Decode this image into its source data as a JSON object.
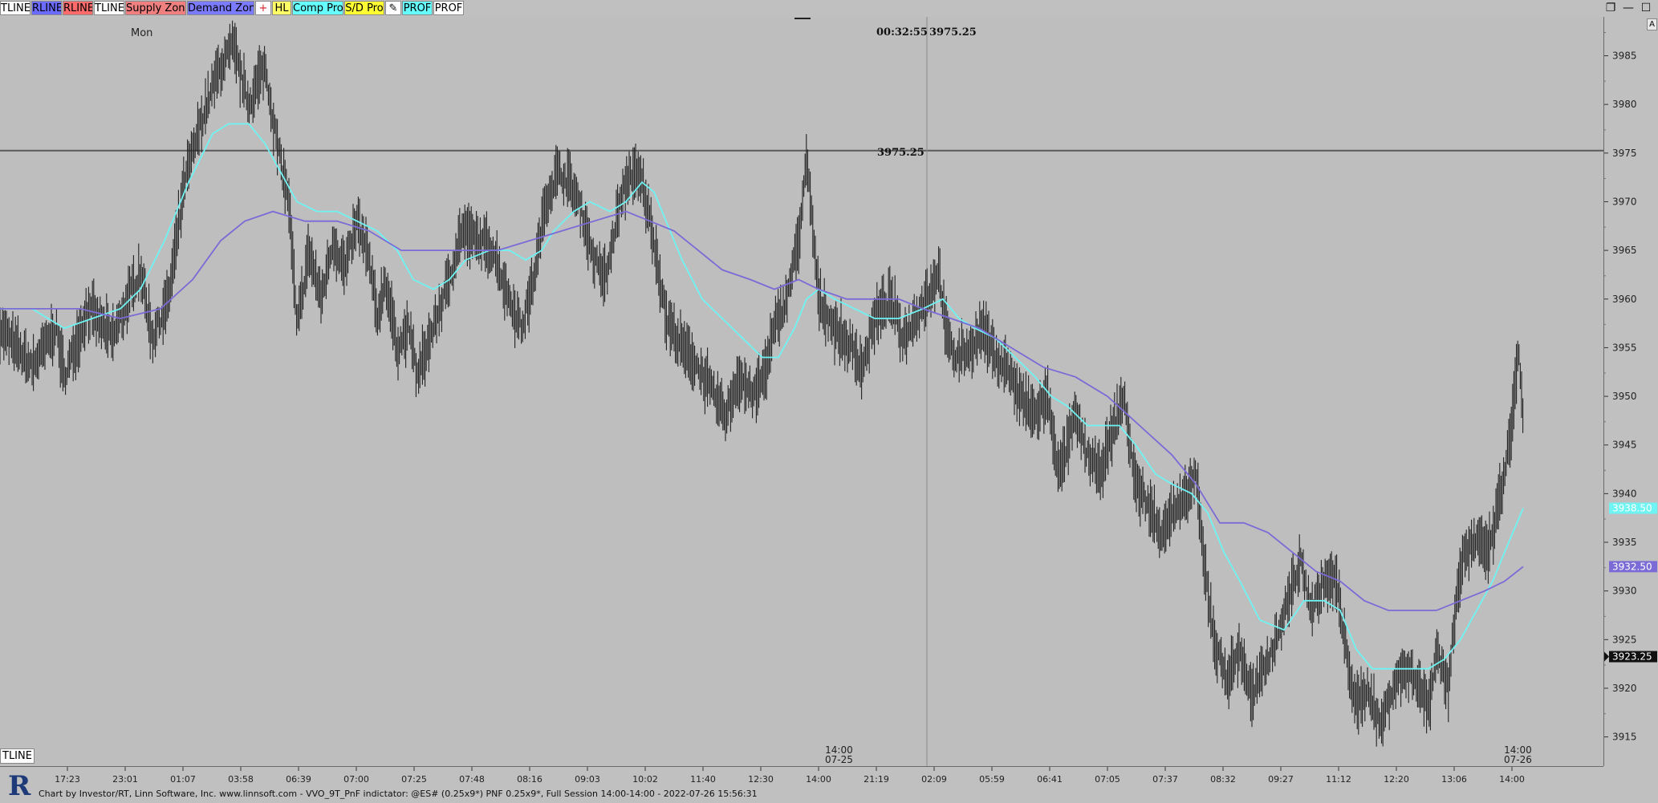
{
  "toolbar": {
    "buttons": [
      {
        "label": "TLINE",
        "bg": "#ffffff",
        "color": "#000000"
      },
      {
        "label": "RLINE",
        "bg": "#6b6bff",
        "color": "#000000"
      },
      {
        "label": "RLINE",
        "bg": "#ff6b6b",
        "color": "#000000"
      },
      {
        "label": "TLINE",
        "bg": "#ffffff",
        "color": "#000000"
      },
      {
        "label": "Supply Zone",
        "bg": "#f08080",
        "color": "#000000"
      },
      {
        "label": "Demand Zone",
        "bg": "#7b7bff",
        "color": "#000000"
      },
      {
        "label": "+",
        "bg": "#ffffff",
        "color": "#d02020"
      },
      {
        "label": "HL",
        "bg": "#ffff66",
        "color": "#000000"
      },
      {
        "label": "Comp Prof",
        "bg": "#66ffff",
        "color": "#000000"
      },
      {
        "label": "S/D Pro",
        "bg": "#ffff33",
        "color": "#000000"
      },
      {
        "label": "✎",
        "bg": "#ffffff",
        "color": "#000000"
      },
      {
        "label": "PROF",
        "bg": "#66ffff",
        "color": "#000000"
      },
      {
        "label": "PROF",
        "bg": "#ffffff",
        "color": "#000000"
      }
    ],
    "window_controls": [
      "❐",
      "—",
      "☐"
    ]
  },
  "chart": {
    "day_label": "Mon",
    "cursor_readout_time": "00:32:55",
    "cursor_readout_price": "3975.25",
    "hline_label": "3975.25",
    "tline_label": "TLINE",
    "axis_corner_label": "A",
    "session_marker_mid": {
      "time": "14:00",
      "date": "07-25"
    },
    "session_marker_end": {
      "time": "14:00",
      "date": "07-26"
    },
    "colors": {
      "bars": "#222222",
      "fast_ma": "#6ff3f3",
      "slow_ma": "#7a6bd6",
      "hline": "#5a5a5a",
      "last_price_bg": "#111111"
    },
    "price_labels": {
      "fast_ma": "3938.50",
      "slow_ma": "3932.50",
      "last": "3923.25"
    }
  },
  "chart_data": {
    "type": "bar",
    "instrument": "@ES#",
    "ylim": [
      3912,
      3989
    ],
    "y_ticks": [
      "3985",
      "3980",
      "3975",
      "3970",
      "3965",
      "3960",
      "3955",
      "3950",
      "3945",
      "3940",
      "3935",
      "3930",
      "3925",
      "3920",
      "3915"
    ],
    "x_ticks": [
      "17:23",
      "23:01",
      "01:07",
      "03:58",
      "06:39",
      "07:00",
      "07:25",
      "07:48",
      "08:16",
      "09:03",
      "10:02",
      "11:40",
      "12:30",
      "14:00",
      "21:19",
      "02:09",
      "05:59",
      "06:41",
      "07:05",
      "07:37",
      "08:32",
      "09:27",
      "11:12",
      "12:20",
      "13:06",
      "14:00"
    ],
    "price_path": [
      [
        0,
        3957
      ],
      [
        40,
        3953
      ],
      [
        70,
        3957
      ],
      [
        80,
        3952
      ],
      [
        110,
        3959
      ],
      [
        140,
        3956
      ],
      [
        175,
        3963
      ],
      [
        190,
        3956
      ],
      [
        210,
        3960
      ],
      [
        230,
        3972
      ],
      [
        250,
        3978
      ],
      [
        270,
        3983
      ],
      [
        290,
        3986
      ],
      [
        310,
        3980
      ],
      [
        330,
        3984
      ],
      [
        345,
        3976
      ],
      [
        360,
        3970
      ],
      [
        370,
        3957
      ],
      [
        385,
        3965
      ],
      [
        400,
        3960
      ],
      [
        415,
        3966
      ],
      [
        430,
        3963
      ],
      [
        445,
        3968
      ],
      [
        460,
        3964
      ],
      [
        470,
        3958
      ],
      [
        480,
        3962
      ],
      [
        495,
        3955
      ],
      [
        510,
        3957
      ],
      [
        520,
        3952
      ],
      [
        540,
        3957
      ],
      [
        560,
        3962
      ],
      [
        575,
        3967
      ],
      [
        595,
        3966
      ],
      [
        615,
        3965
      ],
      [
        630,
        3961
      ],
      [
        650,
        3957
      ],
      [
        665,
        3962
      ],
      [
        680,
        3970
      ],
      [
        695,
        3973
      ],
      [
        710,
        3972
      ],
      [
        725,
        3969
      ],
      [
        740,
        3964
      ],
      [
        755,
        3962
      ],
      [
        770,
        3969
      ],
      [
        785,
        3973
      ],
      [
        800,
        3972
      ],
      [
        815,
        3966
      ],
      [
        830,
        3958
      ],
      [
        850,
        3955
      ],
      [
        870,
        3953
      ],
      [
        890,
        3950
      ],
      [
        905,
        3948
      ],
      [
        920,
        3952
      ],
      [
        940,
        3950
      ],
      [
        955,
        3953
      ],
      [
        965,
        3957
      ],
      [
        980,
        3960
      ],
      [
        995,
        3966
      ],
      [
        1005,
        3974
      ],
      [
        1010,
        3970
      ],
      [
        1020,
        3960
      ],
      [
        1040,
        3957
      ],
      [
        1060,
        3955
      ],
      [
        1075,
        3953
      ],
      [
        1090,
        3958
      ],
      [
        1110,
        3960
      ],
      [
        1125,
        3956
      ],
      [
        1140,
        3958
      ],
      [
        1160,
        3961
      ],
      [
        1170,
        3963
      ],
      [
        1180,
        3956
      ],
      [
        1190,
        3954
      ],
      [
        1210,
        3955
      ],
      [
        1225,
        3957
      ],
      [
        1240,
        3954
      ],
      [
        1255,
        3953
      ],
      [
        1270,
        3950
      ],
      [
        1290,
        3948
      ],
      [
        1305,
        3950
      ],
      [
        1320,
        3942
      ],
      [
        1340,
        3948
      ],
      [
        1355,
        3944
      ],
      [
        1370,
        3942
      ],
      [
        1385,
        3946
      ],
      [
        1400,
        3950
      ],
      [
        1415,
        3941
      ],
      [
        1430,
        3939
      ],
      [
        1445,
        3936
      ],
      [
        1460,
        3938
      ],
      [
        1475,
        3939
      ],
      [
        1490,
        3942
      ],
      [
        1500,
        3933
      ],
      [
        1515,
        3924
      ],
      [
        1530,
        3921
      ],
      [
        1545,
        3924
      ],
      [
        1560,
        3919
      ],
      [
        1575,
        3922
      ],
      [
        1590,
        3925
      ],
      [
        1605,
        3929
      ],
      [
        1620,
        3933
      ],
      [
        1635,
        3928
      ],
      [
        1650,
        3931
      ],
      [
        1665,
        3931
      ],
      [
        1675,
        3925
      ],
      [
        1690,
        3918
      ],
      [
        1705,
        3920
      ],
      [
        1720,
        3916
      ],
      [
        1735,
        3920
      ],
      [
        1750,
        3922
      ],
      [
        1765,
        3921
      ],
      [
        1780,
        3918
      ],
      [
        1790,
        3924
      ],
      [
        1805,
        3920
      ],
      [
        1815,
        3930
      ],
      [
        1825,
        3934
      ],
      [
        1840,
        3935
      ],
      [
        1855,
        3934
      ],
      [
        1865,
        3938
      ],
      [
        1875,
        3942
      ],
      [
        1885,
        3948
      ],
      [
        1892,
        3955
      ],
      [
        1898,
        3948
      ]
    ],
    "series": [
      {
        "name": "fast_ma",
        "points": [
          [
            0,
            3959
          ],
          [
            40,
            3959
          ],
          [
            80,
            3957
          ],
          [
            115,
            3958
          ],
          [
            150,
            3959
          ],
          [
            175,
            3961
          ],
          [
            205,
            3966
          ],
          [
            235,
            3972
          ],
          [
            265,
            3977
          ],
          [
            285,
            3978
          ],
          [
            310,
            3978
          ],
          [
            330,
            3976
          ],
          [
            350,
            3973
          ],
          [
            370,
            3970
          ],
          [
            395,
            3969
          ],
          [
            420,
            3969
          ],
          [
            445,
            3968
          ],
          [
            470,
            3967
          ],
          [
            495,
            3965
          ],
          [
            515,
            3962
          ],
          [
            540,
            3961
          ],
          [
            560,
            3962
          ],
          [
            580,
            3964
          ],
          [
            610,
            3965
          ],
          [
            635,
            3965
          ],
          [
            655,
            3964
          ],
          [
            675,
            3965
          ],
          [
            690,
            3967
          ],
          [
            715,
            3969
          ],
          [
            735,
            3970
          ],
          [
            760,
            3969
          ],
          [
            780,
            3970
          ],
          [
            800,
            3972
          ],
          [
            815,
            3971
          ],
          [
            830,
            3968
          ],
          [
            850,
            3964
          ],
          [
            875,
            3960
          ],
          [
            900,
            3958
          ],
          [
            925,
            3956
          ],
          [
            950,
            3954
          ],
          [
            970,
            3954
          ],
          [
            990,
            3957
          ],
          [
            1005,
            3960
          ],
          [
            1020,
            3961
          ],
          [
            1040,
            3960
          ],
          [
            1065,
            3959
          ],
          [
            1090,
            3958
          ],
          [
            1120,
            3958
          ],
          [
            1150,
            3959
          ],
          [
            1175,
            3960
          ],
          [
            1195,
            3958
          ],
          [
            1215,
            3957
          ],
          [
            1240,
            3956
          ],
          [
            1265,
            3954
          ],
          [
            1290,
            3952
          ],
          [
            1310,
            3950
          ],
          [
            1330,
            3949
          ],
          [
            1355,
            3947
          ],
          [
            1375,
            3947
          ],
          [
            1395,
            3947
          ],
          [
            1415,
            3945
          ],
          [
            1440,
            3942
          ],
          [
            1460,
            3941
          ],
          [
            1485,
            3940
          ],
          [
            1505,
            3938
          ],
          [
            1525,
            3934
          ],
          [
            1545,
            3931
          ],
          [
            1570,
            3927
          ],
          [
            1600,
            3926
          ],
          [
            1625,
            3929
          ],
          [
            1650,
            3929
          ],
          [
            1670,
            3928
          ],
          [
            1690,
            3924
          ],
          [
            1710,
            3922
          ],
          [
            1735,
            3922
          ],
          [
            1760,
            3922
          ],
          [
            1780,
            3922
          ],
          [
            1800,
            3923
          ],
          [
            1820,
            3925
          ],
          [
            1840,
            3928
          ],
          [
            1860,
            3931
          ],
          [
            1880,
            3935
          ],
          [
            1898,
            3938.5
          ]
        ]
      },
      {
        "name": "slow_ma",
        "points": [
          [
            0,
            3959
          ],
          [
            50,
            3959
          ],
          [
            100,
            3959
          ],
          [
            150,
            3958
          ],
          [
            200,
            3959
          ],
          [
            240,
            3962
          ],
          [
            275,
            3966
          ],
          [
            305,
            3968
          ],
          [
            340,
            3969
          ],
          [
            380,
            3968
          ],
          [
            420,
            3968
          ],
          [
            460,
            3967
          ],
          [
            500,
            3965
          ],
          [
            540,
            3965
          ],
          [
            580,
            3965
          ],
          [
            620,
            3965
          ],
          [
            660,
            3966
          ],
          [
            700,
            3967
          ],
          [
            740,
            3968
          ],
          [
            780,
            3969
          ],
          [
            810,
            3968
          ],
          [
            840,
            3967
          ],
          [
            870,
            3965
          ],
          [
            900,
            3963
          ],
          [
            935,
            3962
          ],
          [
            965,
            3961
          ],
          [
            995,
            3962
          ],
          [
            1020,
            3961
          ],
          [
            1055,
            3960
          ],
          [
            1090,
            3960
          ],
          [
            1120,
            3960
          ],
          [
            1150,
            3959
          ],
          [
            1185,
            3958
          ],
          [
            1220,
            3957
          ],
          [
            1260,
            3955
          ],
          [
            1300,
            3953
          ],
          [
            1340,
            3952
          ],
          [
            1380,
            3950
          ],
          [
            1420,
            3947
          ],
          [
            1460,
            3944
          ],
          [
            1490,
            3941
          ],
          [
            1520,
            3937
          ],
          [
            1550,
            3937
          ],
          [
            1580,
            3936
          ],
          [
            1610,
            3934
          ],
          [
            1640,
            3932
          ],
          [
            1670,
            3931
          ],
          [
            1700,
            3929
          ],
          [
            1730,
            3928
          ],
          [
            1760,
            3928
          ],
          [
            1790,
            3928
          ],
          [
            1820,
            3929
          ],
          [
            1850,
            3930
          ],
          [
            1875,
            3931
          ],
          [
            1898,
            3932.5
          ]
        ]
      }
    ]
  },
  "footer": {
    "text": "Chart by Investor/RT, Linn Software, Inc. www.linnsoft.com - VVO_9T_PnF indictator: @ES# (0.25x9*) PNF 0.25x9*, Full Session 14:00-14:00 - 2022-07-26 15:56:31",
    "logo_letter": "R"
  }
}
